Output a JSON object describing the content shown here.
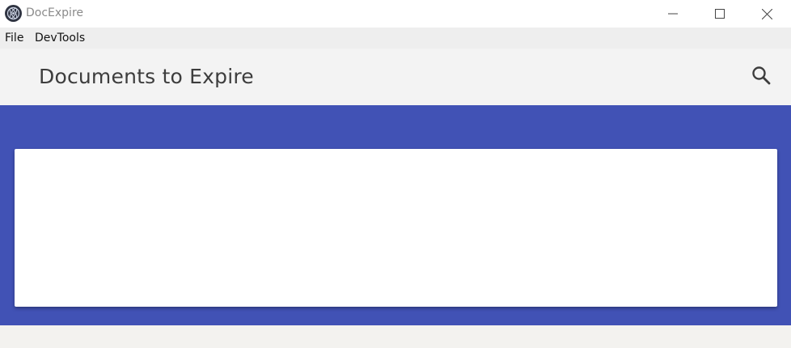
{
  "window": {
    "title": "DocExpire",
    "controls": {
      "minimize_icon": "minimize-icon",
      "maximize_icon": "maximize-icon",
      "close_icon": "close-icon"
    }
  },
  "menubar": {
    "items": [
      {
        "label": "File"
      },
      {
        "label": "DevTools"
      }
    ]
  },
  "appbar": {
    "title": "Documents to Expire",
    "search_icon": "search-icon"
  },
  "colors": {
    "hero_background": "#4152b5",
    "card_background": "#ffffff",
    "appbar_background": "#f3f3f3"
  }
}
